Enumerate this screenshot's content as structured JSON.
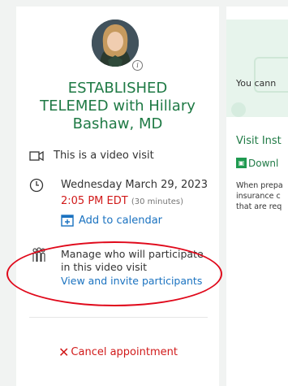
{
  "appointment": {
    "title_line1": "ESTABLISHED",
    "title_line2": "TELEMED with Hillary",
    "title_line3": "Bashaw, MD"
  },
  "details": {
    "visit_type": "This is a video visit",
    "date": "Wednesday March 29, 2023",
    "time": "2:05 PM EDT",
    "duration": "(30 minutes)",
    "add_calendar": "Add to calendar"
  },
  "participants": {
    "manage_line1": "Manage who will participate",
    "manage_line2": "in this video visit",
    "link": "View and invite participants"
  },
  "cancel": {
    "icon": "✕",
    "label": "Cancel appointment"
  },
  "right_panel": {
    "cannot_text": "You cann",
    "instructions_title": "Visit Inst",
    "download_label": "Downl",
    "para_line1": "When prepa",
    "para_line2": "insurance c",
    "para_line3": "that are req"
  },
  "colors": {
    "accent_green": "#1f7a45",
    "link_blue": "#1a72c0",
    "alert_red": "#d11a1a",
    "annotation_red": "#e0091b"
  }
}
